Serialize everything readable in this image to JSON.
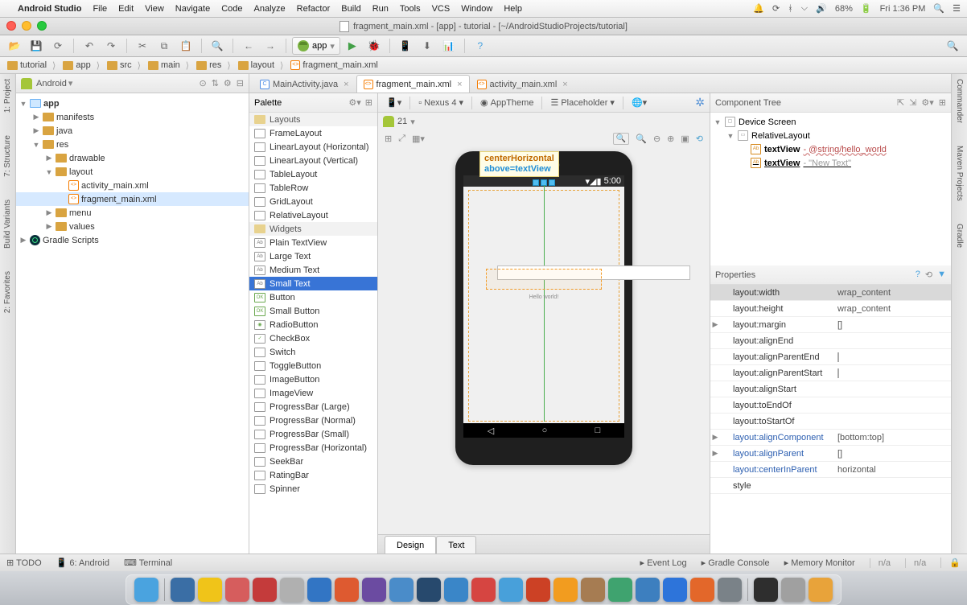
{
  "menubar": {
    "app": "Android Studio",
    "items": [
      "File",
      "Edit",
      "View",
      "Navigate",
      "Code",
      "Analyze",
      "Refactor",
      "Build",
      "Run",
      "Tools",
      "VCS",
      "Window",
      "Help"
    ],
    "battery": "68%",
    "clock": "Fri 1:36 PM"
  },
  "window_title": "fragment_main.xml - [app] - tutorial - [~/AndroidStudioProjects/tutorial]",
  "run_config": "app",
  "breadcrumb": [
    "tutorial",
    "app",
    "src",
    "main",
    "res",
    "layout",
    "fragment_main.xml"
  ],
  "left_gutter": [
    "1: Project",
    "7: Structure",
    "Build Variants",
    "2: Favorites"
  ],
  "right_gutter": [
    "Commander",
    "Maven Projects",
    "Gradle"
  ],
  "project_view": "Android",
  "project_tree": [
    {
      "d": 0,
      "t": "app",
      "ic": "mod",
      "tw": "▼",
      "bold": true
    },
    {
      "d": 1,
      "t": "manifests",
      "ic": "fold",
      "tw": "▶"
    },
    {
      "d": 1,
      "t": "java",
      "ic": "fold",
      "tw": "▶"
    },
    {
      "d": 1,
      "t": "res",
      "ic": "fold",
      "tw": "▼"
    },
    {
      "d": 2,
      "t": "drawable",
      "ic": "fold",
      "tw": "▶"
    },
    {
      "d": 2,
      "t": "layout",
      "ic": "fold",
      "tw": "▼"
    },
    {
      "d": 3,
      "t": "activity_main.xml",
      "ic": "xml",
      "tw": ""
    },
    {
      "d": 3,
      "t": "fragment_main.xml",
      "ic": "xml",
      "tw": "",
      "sel": true
    },
    {
      "d": 2,
      "t": "menu",
      "ic": "fold",
      "tw": "▶"
    },
    {
      "d": 2,
      "t": "values",
      "ic": "fold",
      "tw": "▶"
    },
    {
      "d": 0,
      "t": "Gradle Scripts",
      "ic": "grad",
      "tw": "▶"
    }
  ],
  "editor_tabs": [
    {
      "label": "MainActivity.java",
      "type": "j",
      "active": false
    },
    {
      "label": "fragment_main.xml",
      "type": "x",
      "active": true
    },
    {
      "label": "activity_main.xml",
      "type": "x",
      "active": false
    }
  ],
  "palette_title": "Palette",
  "palette": [
    {
      "t": "Layouts",
      "cat": true
    },
    {
      "t": "FrameLayout"
    },
    {
      "t": "LinearLayout (Horizontal)"
    },
    {
      "t": "LinearLayout (Vertical)"
    },
    {
      "t": "TableLayout"
    },
    {
      "t": "TableRow"
    },
    {
      "t": "GridLayout"
    },
    {
      "t": "RelativeLayout"
    },
    {
      "t": "Widgets",
      "cat": true
    },
    {
      "t": "Plain TextView",
      "ab": true
    },
    {
      "t": "Large Text",
      "ab": true
    },
    {
      "t": "Medium Text",
      "ab": true
    },
    {
      "t": "Small Text",
      "sel": true,
      "ab": true
    },
    {
      "t": "Button",
      "ok": true
    },
    {
      "t": "Small Button",
      "ok": true
    },
    {
      "t": "RadioButton",
      "radio": true
    },
    {
      "t": "CheckBox",
      "check": true
    },
    {
      "t": "Switch"
    },
    {
      "t": "ToggleButton"
    },
    {
      "t": "ImageButton"
    },
    {
      "t": "ImageView"
    },
    {
      "t": "ProgressBar (Large)"
    },
    {
      "t": "ProgressBar (Normal)"
    },
    {
      "t": "ProgressBar (Small)"
    },
    {
      "t": "ProgressBar (Horizontal)"
    },
    {
      "t": "SeekBar"
    },
    {
      "t": "RatingBar"
    },
    {
      "t": "Spinner"
    }
  ],
  "design_tb": {
    "device": "Nexus 4",
    "theme": "AppTheme",
    "placeholder": "Placeholder",
    "api": "21"
  },
  "hint1": "centerHorizontal",
  "hint2": "above=textView",
  "status_time": "5:00",
  "hello": "Hello world!",
  "design_tabs": {
    "design": "Design",
    "text": "Text"
  },
  "ct_title": "Component Tree",
  "ct": [
    {
      "d": 0,
      "tw": "▼",
      "ic": "dev",
      "t": "Device Screen"
    },
    {
      "d": 1,
      "tw": "▼",
      "ic": "rl",
      "t": "RelativeLayout"
    },
    {
      "d": 2,
      "tw": "",
      "ic": "ab",
      "t": "textView",
      "anno": " - @string/hello_world",
      "cls": "red",
      "bold": true
    },
    {
      "d": 2,
      "tw": "",
      "ic": "ab",
      "t": "textView",
      "anno": " - \"New Text\"",
      "cls": "grey",
      "bold": true,
      "u": true
    }
  ],
  "prop_title": "Properties",
  "properties": [
    {
      "k": "layout:width",
      "v": "wrap_content",
      "hd": true
    },
    {
      "k": "layout:height",
      "v": "wrap_content"
    },
    {
      "k": "layout:margin",
      "v": "[]",
      "exp": true
    },
    {
      "k": "layout:alignEnd",
      "v": ""
    },
    {
      "k": "layout:alignParentEnd",
      "v": "",
      "chk": true
    },
    {
      "k": "layout:alignParentStart",
      "v": "",
      "chk": true
    },
    {
      "k": "layout:alignStart",
      "v": ""
    },
    {
      "k": "layout:toEndOf",
      "v": ""
    },
    {
      "k": "layout:toStartOf",
      "v": ""
    },
    {
      "k": "layout:alignComponent",
      "v": "[bottom:top]",
      "exp": true,
      "blue": true
    },
    {
      "k": "layout:alignParent",
      "v": "[]",
      "exp": true,
      "blue": true
    },
    {
      "k": "layout:centerInParent",
      "v": "horizontal",
      "blue": true
    },
    {
      "k": "style",
      "v": ""
    }
  ],
  "status_ide": {
    "left": [
      "TODO",
      "6: Android",
      "Terminal"
    ],
    "right": [
      "Event Log",
      "Gradle Console",
      "Memory Monitor"
    ],
    "na": "n/a"
  },
  "dock_colors": [
    "#4aa3df",
    "#3a6ea5",
    "#f0c419",
    "#d65d5d",
    "#c43b3b",
    "#b0b0b0",
    "#3275c4",
    "#de5a30",
    "#6b4ba1",
    "#4a8cc9",
    "#27496d",
    "#3a86c8",
    "#d64541",
    "#48a0da",
    "#cc4125",
    "#f29c1f",
    "#a67c52",
    "#3fa36f",
    "#3d7fbf",
    "#2d74da",
    "#e3672a",
    "#7a8288",
    "#2e2e2e",
    "#a0a0a0",
    "#e8a33a"
  ]
}
